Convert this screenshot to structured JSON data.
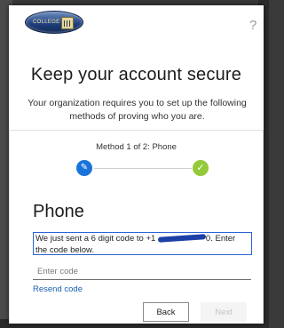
{
  "header": {
    "logo_text": "COLLEGE",
    "help_label": "?"
  },
  "title": "Keep your account secure",
  "subtitle": "Your organization requires you to set up the following methods of proving who you are.",
  "progress": {
    "method_label": "Method 1 of 2: Phone",
    "steps": [
      {
        "icon": "pencil-icon",
        "color": "#1a73d9",
        "state": "current"
      },
      {
        "icon": "checkmark-icon",
        "color": "#94c93a",
        "state": "upcoming"
      }
    ]
  },
  "phone": {
    "heading": "Phone",
    "message_prefix": "We just sent a 6 digit code to +1 ",
    "message_suffix": "0. Enter the code below.",
    "code_input_placeholder": "Enter code",
    "code_input_value": "",
    "resend_label": "Resend code"
  },
  "buttons": {
    "back_label": "Back",
    "next_label": "Next"
  }
}
